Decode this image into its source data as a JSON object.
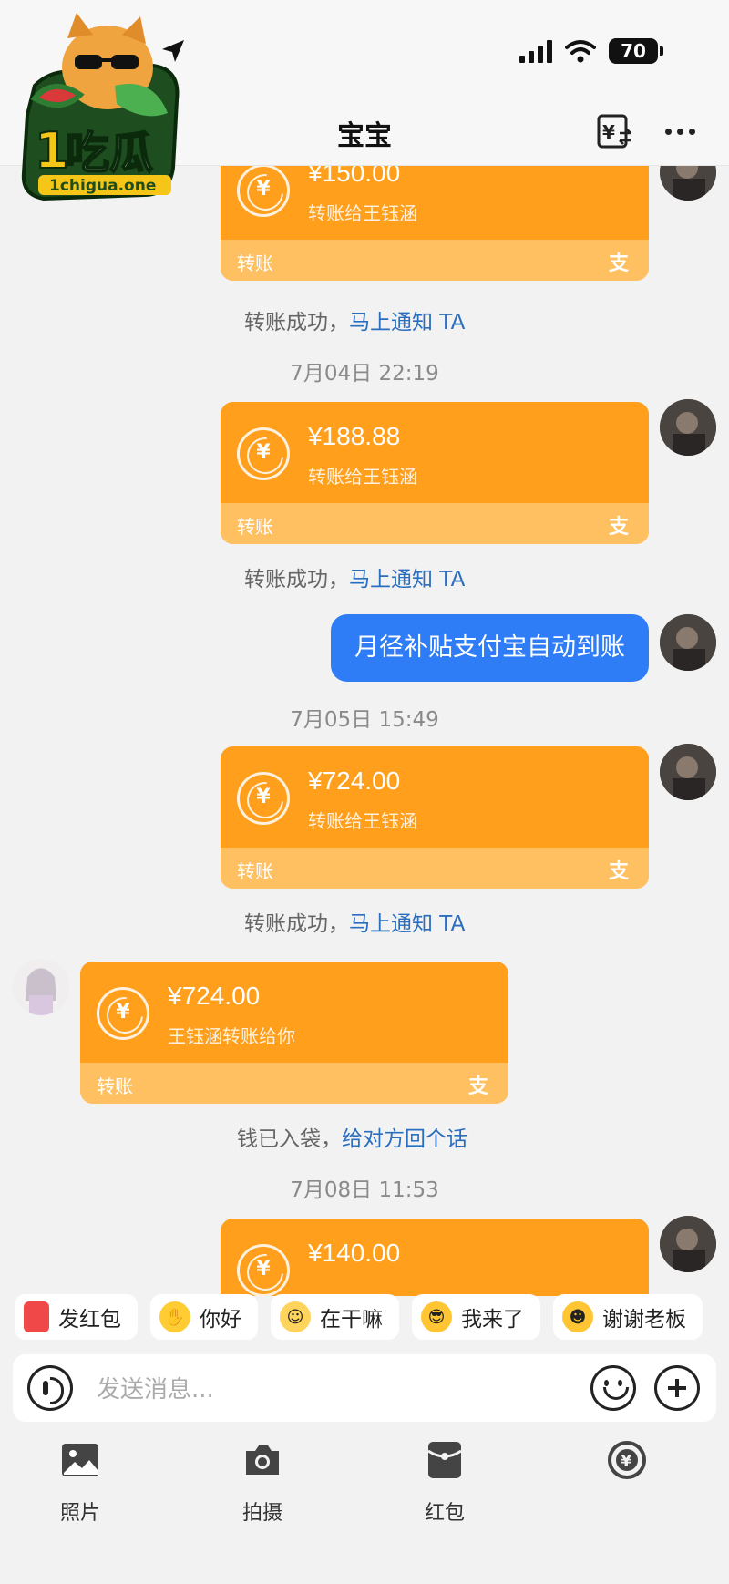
{
  "status_bar": {
    "battery": "70"
  },
  "logo": {
    "text": "1吃瓜",
    "site": "1chigua.one"
  },
  "header": {
    "title": "宝宝",
    "transfer_icon": "rmb-transfer-icon",
    "more_icon": "more-icon"
  },
  "messages": [
    {
      "amount": "¥150.00",
      "desc": "转账给王钰涵",
      "label": "转账",
      "ali": "支"
    },
    {
      "amount": "¥188.88",
      "desc": "转账给王钰涵",
      "label": "转账",
      "ali": "支"
    },
    {
      "text": "月径补贴支付宝自动到账"
    },
    {
      "amount": "¥724.00",
      "desc": "转账给王钰涵",
      "label": "转账",
      "ali": "支"
    },
    {
      "amount": "¥724.00",
      "desc": "王钰涵转账给你",
      "label": "转账",
      "ali": "支"
    },
    {
      "amount": "¥140.00"
    }
  ],
  "notes": {
    "success": "转账成功，",
    "notify": "马上通知 TA",
    "received": "钱已入袋，",
    "reply": "给对方回个话"
  },
  "times": [
    "7月04日 22:19",
    "7月05日 15:49",
    "7月08日 11:53"
  ],
  "quick_replies": [
    "发红包",
    "你好",
    "在干嘛",
    "我来了",
    "谢谢老板"
  ],
  "input": {
    "placeholder": "发送消息..."
  },
  "toolbar": [
    "照片",
    "拍摄",
    "红包"
  ],
  "colors": {
    "orange": "#ff9f1c",
    "orange_light": "#ffc062",
    "blue": "#2e7cf6",
    "link": "#2a6ebf"
  }
}
